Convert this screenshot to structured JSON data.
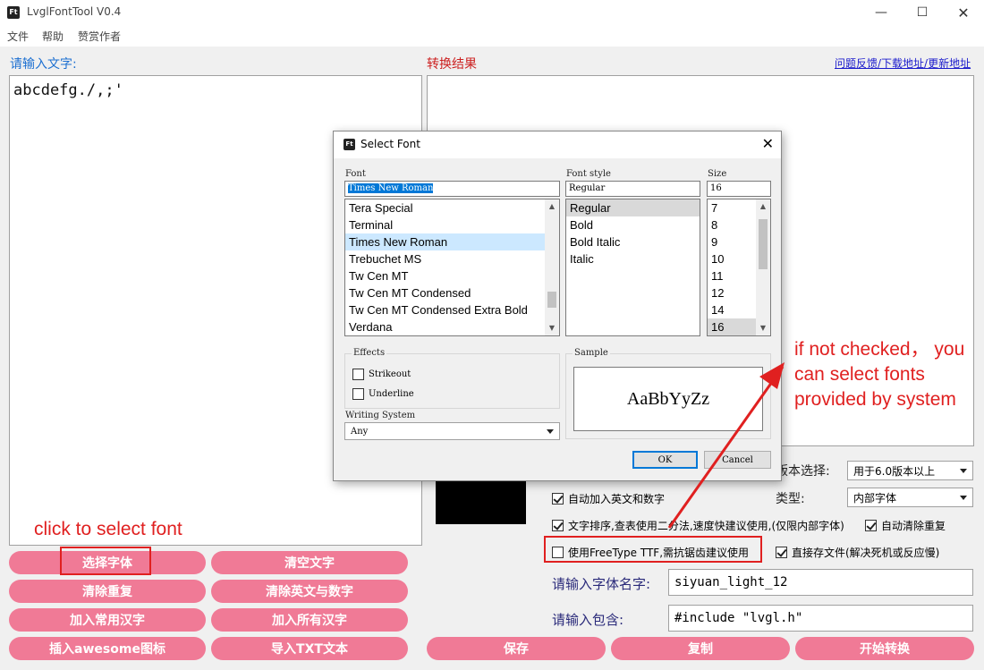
{
  "window": {
    "icon_text": "Ft",
    "title": "LvglFontTool V0.4"
  },
  "menu": [
    "文件",
    "帮助",
    "赞赏作者"
  ],
  "left": {
    "label": "请输入文字:",
    "text": "abcdefg./,;'"
  },
  "right": {
    "label": "转换结果",
    "link": "问题反馈/下载地址/更新地址"
  },
  "left_buttons": [
    [
      "选择字体",
      "清空文字"
    ],
    [
      "清除重复",
      "清除英文与数字"
    ],
    [
      "加入常用汉字",
      "加入所有汉字"
    ],
    [
      "插入awesome图标",
      "导入TXT文本"
    ]
  ],
  "options": {
    "version_label": "版本选择:",
    "version_value": "用于6.0版本以上",
    "type_label": "类型:",
    "type_value": "内部字体",
    "check_auto_add": "自动加入英文和数字",
    "check_sort": "文字排序,查表使用二分法,速度快建议使用,(仅限内部字体)",
    "check_auto_clear": "自动清除重复",
    "check_freetype": "使用FreeType TTF,需抗锯齿建议使用",
    "check_save_file": "直接存文件(解决死机或反应慢)",
    "font_name_label": "请输入字体名字:",
    "font_name_value": "siyuan_light_12",
    "include_label": "请输入包含:",
    "include_value": "#include \"lvgl.h\""
  },
  "bottom_buttons": [
    "保存",
    "复制",
    "开始转换"
  ],
  "dialog": {
    "title": "Select Font",
    "font_label": "Font",
    "font_value": "Times New Roman",
    "fonts": [
      "Tera Special",
      "Terminal",
      "Times New Roman",
      "Trebuchet MS",
      "Tw Cen MT",
      "Tw Cen MT Condensed",
      "Tw Cen MT Condensed Extra Bold",
      "Verdana"
    ],
    "style_label": "Font style",
    "style_value": "Regular",
    "styles": [
      "Regular",
      "Bold",
      "Bold Italic",
      "Italic"
    ],
    "size_label": "Size",
    "size_value": "16",
    "sizes": [
      "7",
      "8",
      "9",
      "10",
      "11",
      "12",
      "14",
      "16"
    ],
    "effects_label": "Effects",
    "strikeout": "Strikeout",
    "underline": "Underline",
    "sample_label": "Sample",
    "sample_text": "AaBbYyZz",
    "writing_system_label": "Writing System",
    "writing_system_value": "Any",
    "ok": "OK",
    "cancel": "Cancel"
  },
  "annotations": {
    "select_font": "click to select font",
    "if_not_checked": "if not checked， you\ncan select fonts\nprovided by system"
  },
  "colors": {
    "pink_button": "#f07a96",
    "annotation_red": "#e02020",
    "label_blue": "#1c6fd1"
  }
}
